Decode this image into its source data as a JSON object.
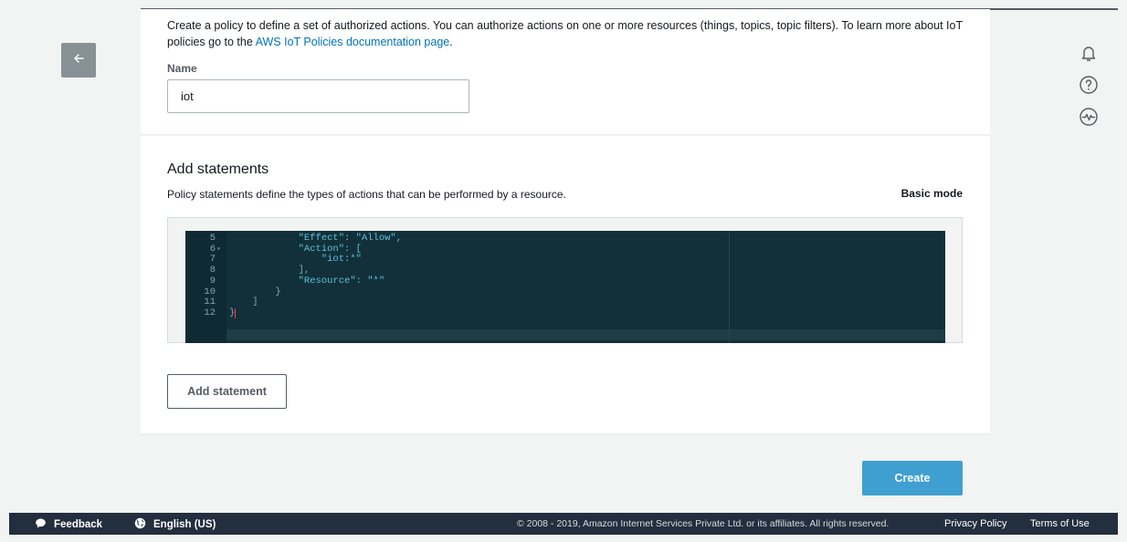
{
  "policy": {
    "intro_text": "Create a policy to define a set of authorized actions. You can authorize actions on one or more resources (things, topics, topic filters). To learn more about IoT policies go to the",
    "intro_link": "AWS IoT Policies documentation page",
    "intro_end": ".",
    "name_label": "Name",
    "name_value": "iot"
  },
  "statements": {
    "title": "Add statements",
    "description": "Policy statements define the types of actions that can be performed by a resource.",
    "mode_link": "Basic mode",
    "add_button": "Add statement",
    "editor_lines": [
      {
        "num": "5",
        "indent": "            ",
        "code": "\"Effect\": \"Allow\","
      },
      {
        "num": "6",
        "indent": "            ",
        "code": "\"Action\": ["
      },
      {
        "num": "7",
        "indent": "                ",
        "code": "\"iot:*\""
      },
      {
        "num": "8",
        "indent": "            ",
        "code": "],"
      },
      {
        "num": "9",
        "indent": "            ",
        "code": "\"Resource\": \"*\""
      },
      {
        "num": "10",
        "indent": "        ",
        "code": "}"
      },
      {
        "num": "11",
        "indent": "    ",
        "code": "]"
      },
      {
        "num": "12",
        "indent": "",
        "code": "}"
      }
    ]
  },
  "actions": {
    "create_button": "Create"
  },
  "footer": {
    "feedback": "Feedback",
    "language": "English (US)",
    "copyright": "© 2008 - 2019, Amazon Internet Services Private Ltd. or its affiliates. All rights reserved.",
    "privacy": "Privacy Policy",
    "terms": "Terms of Use"
  },
  "icons": {
    "back": "arrow-left-icon",
    "notifications": "bell-icon",
    "help": "question-circle-icon",
    "activity": "pulse-icon",
    "feedback": "speech-bubble-icon",
    "language": "globe-icon"
  },
  "colors": {
    "link": "#0073bb",
    "primary_button": "#3f9fd1",
    "editor_bg": "#12303a",
    "footer_bg": "#232f3e"
  }
}
